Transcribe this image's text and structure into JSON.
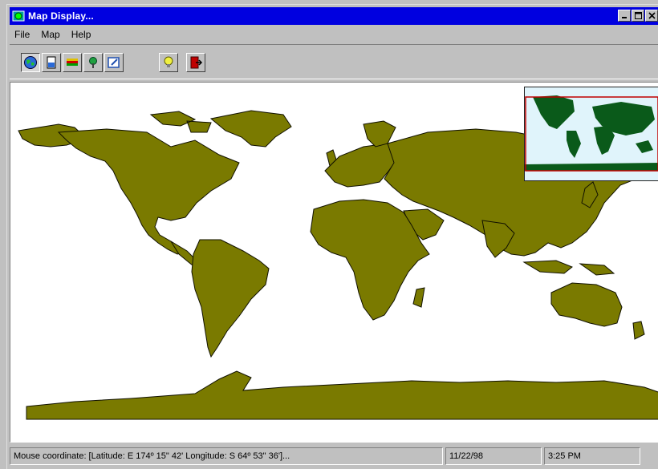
{
  "window": {
    "title": "Map Display...",
    "buttons": {
      "minimize_icon": "minimize-icon",
      "maximize_icon": "maximize-icon",
      "close_icon": "close-icon"
    }
  },
  "menu": {
    "items": [
      {
        "label": "File"
      },
      {
        "label": "Map"
      },
      {
        "label": "Help"
      }
    ]
  },
  "toolbar": {
    "buttons": [
      {
        "icon": "globe-icon"
      },
      {
        "icon": "document-icon"
      },
      {
        "icon": "layers-icon"
      },
      {
        "icon": "pin-icon"
      },
      {
        "icon": "edit-icon"
      },
      {
        "icon": "lightbulb-icon"
      },
      {
        "icon": "exit-icon"
      }
    ]
  },
  "colors": {
    "land": "#7a7a00",
    "ocean": "#ffffff",
    "overview_land": "#0a5a1a",
    "overview_sea": "#e0f4fb",
    "overview_frame": "#c00000",
    "titlebar": "#0000e0"
  },
  "status": {
    "coordinate": "Mouse coordinate: [Latitude: E 174º 15\" 42'  Longitude: S 64º 53\" 36']...",
    "date": "11/22/98",
    "time": "3:25 PM"
  }
}
